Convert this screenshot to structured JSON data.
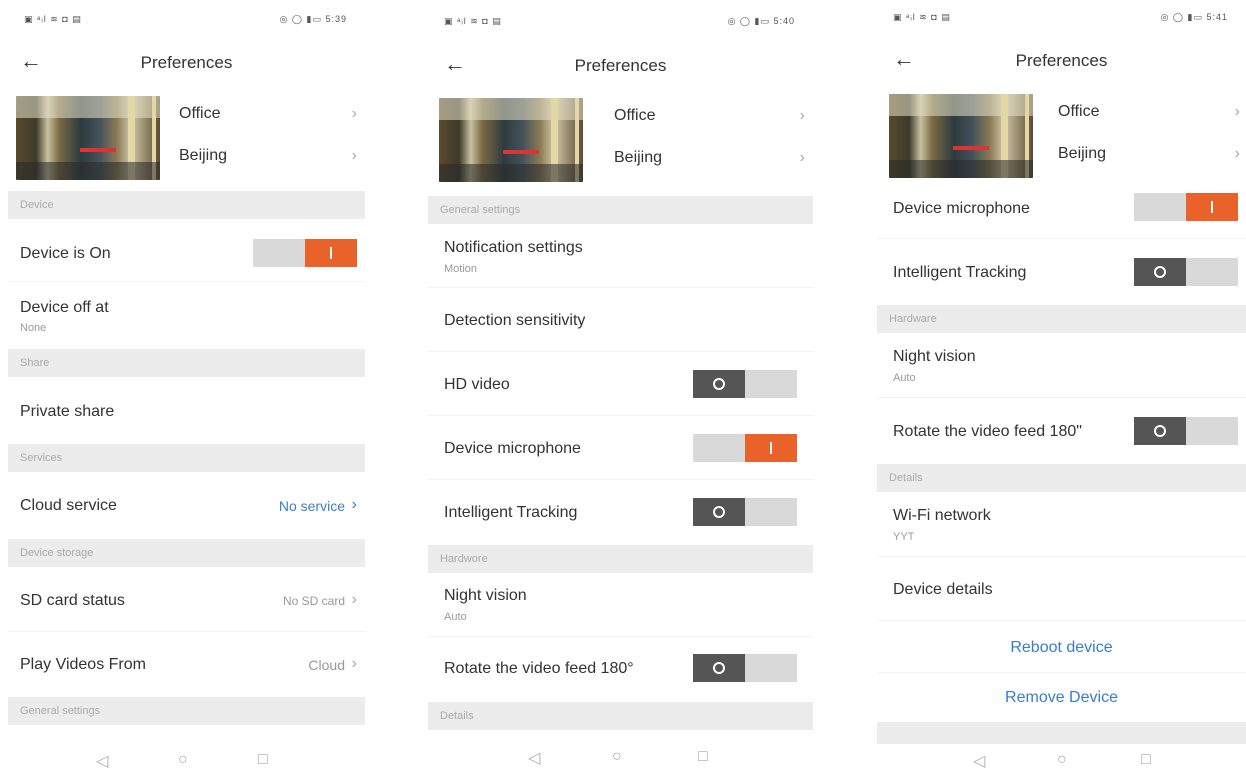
{
  "status": {
    "left_icons": "▣ ᵃᵢl ≋ ◘ ▤",
    "right_icons": "◎ ◯ ▮▭",
    "times": [
      "5:39",
      "5:40",
      "5:41"
    ]
  },
  "header": {
    "title": "Preferences",
    "back_icon": "arrow-left-icon"
  },
  "device_info": {
    "name": "Office",
    "location": "Beijing"
  },
  "sections": {
    "device": "Device",
    "share": "Share",
    "services": "Services",
    "device_storage": "Device storage",
    "general_settings": "General settings",
    "hardware": "Hardware",
    "hardware_alt": "Hardwore",
    "details": "Details"
  },
  "rows": {
    "device_is_on": "Device is On",
    "device_off_at": "Device off at",
    "device_off_at_value": "None",
    "private_share": "Private share",
    "cloud_service": "Cloud service",
    "cloud_service_value": "No service",
    "sd_card_status": "SD card status",
    "sd_card_value": "No SD card",
    "play_videos_from": "Play Videos From",
    "play_videos_value": "Cloud",
    "notification_settings": "Notification settings",
    "notification_value": "Motion",
    "detection_sensitivity": "Detection sensitivity",
    "hd_video": "HD video",
    "device_microphone": "Device microphone",
    "intelligent_tracking": "Intelligent Tracking",
    "night_vision": "Night vision",
    "night_vision_value": "Auto",
    "rotate_video": "Rotate the video feed 180°",
    "rotate_video_alt": "Rotate the video feed 180\"",
    "wifi_network": "Wi-Fi network",
    "wifi_value": "YYT",
    "device_details": "Device details"
  },
  "toggles": {
    "device_is_on": "on",
    "hd_video": "off",
    "device_microphone": "on",
    "intelligent_tracking": "off",
    "rotate_video": "off"
  },
  "actions": {
    "reboot": "Reboot device",
    "remove": "Remove Device"
  },
  "navbar": {
    "back": "◁",
    "home": "○",
    "recents": "□"
  },
  "colors": {
    "accent_orange": "#e9622a",
    "link_blue": "#3a7ccf",
    "section_bg": "#ececec"
  }
}
